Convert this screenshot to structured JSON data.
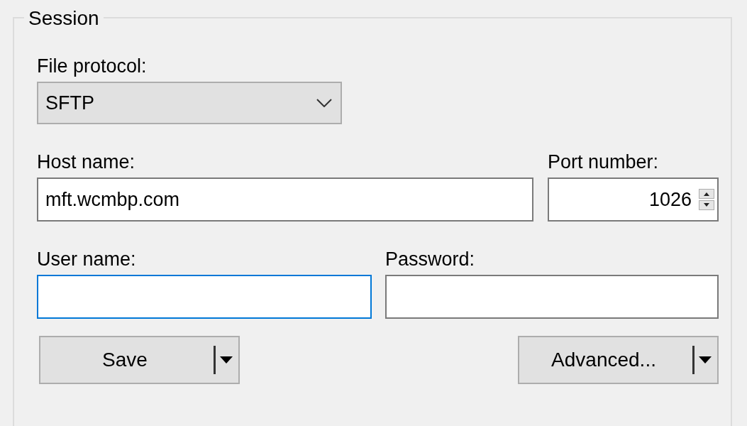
{
  "group": {
    "title": "Session"
  },
  "file_protocol": {
    "label": "File protocol:",
    "value": "SFTP"
  },
  "host": {
    "label": "Host name:",
    "value": "mft.wcmbp.com"
  },
  "port": {
    "label": "Port number:",
    "value": "1026"
  },
  "user": {
    "label": "User name:",
    "focused": true
  },
  "password": {
    "label": "Password:",
    "focused": false
  },
  "buttons": [
    {
      "label": "Save"
    },
    {
      "label": "Advanced..."
    }
  ]
}
